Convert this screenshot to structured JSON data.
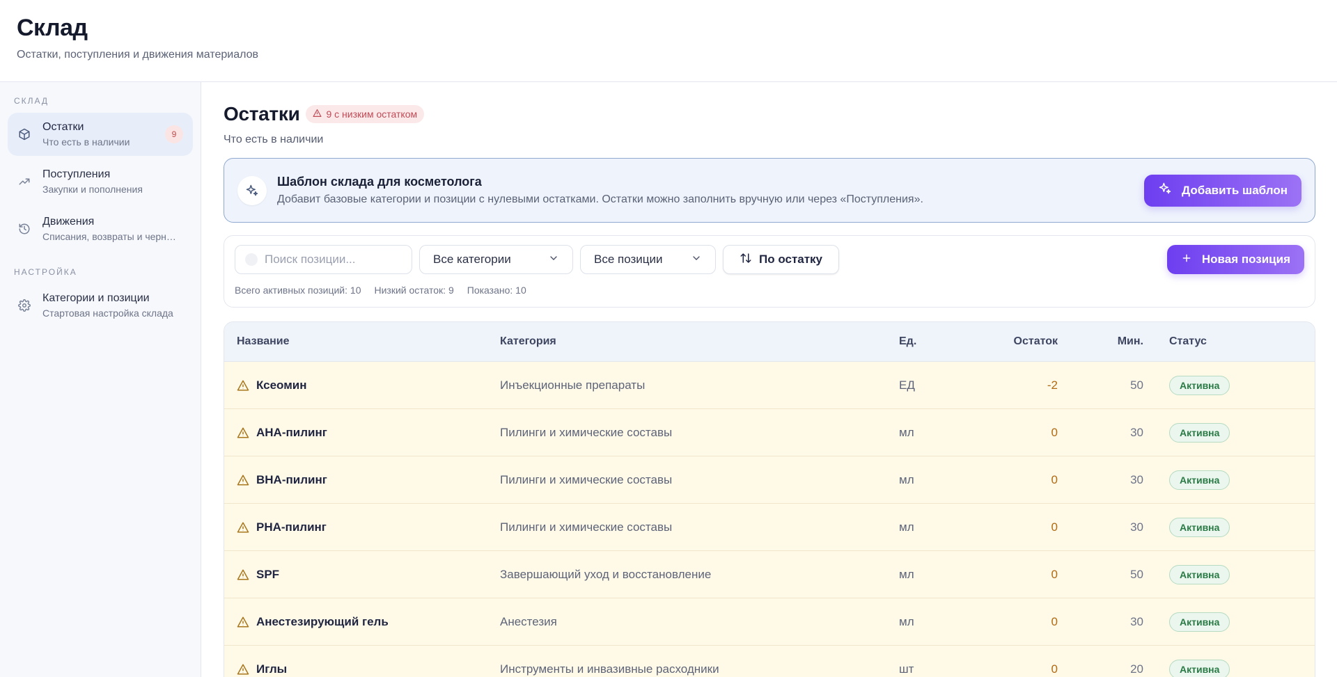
{
  "header": {
    "title": "Склад",
    "subtitle": "Остатки, поступления и движения материалов"
  },
  "sidebar": {
    "section_warehouse": "СКЛАД",
    "section_settings": "НАСТРОЙКА",
    "items": [
      {
        "title": "Остатки",
        "desc": "Что есть в наличии",
        "badge": "9",
        "icon": "box-icon",
        "active": true
      },
      {
        "title": "Поступления",
        "desc": "Закупки и пополнения",
        "icon": "trending-up-icon"
      },
      {
        "title": "Движения",
        "desc": "Списания, возвраты и черн…",
        "icon": "history-icon"
      },
      {
        "title": "Категории и позиции",
        "desc": "Стартовая настройка склада",
        "icon": "gear-icon"
      }
    ]
  },
  "main": {
    "title": "Остатки",
    "low_badge": "9 с низким остатком",
    "subtitle": "Что есть в наличии"
  },
  "template": {
    "title": "Шаблон склада для косметолога",
    "desc": "Добавит базовые категории и позиции с нулевыми остатками. Остатки можно заполнить вручную или через «Поступления».",
    "button": "Добавить шаблон"
  },
  "filters": {
    "search_placeholder": "Поиск позиции...",
    "category": "Все категории",
    "positions": "Все позиции",
    "sort": "По остатку",
    "new_button": "Новая позиция",
    "stats": {
      "total": "Всего активных позиций: 10",
      "low": "Низкий остаток: 9",
      "shown": "Показано: 10"
    }
  },
  "table": {
    "headers": {
      "name": "Название",
      "category": "Категория",
      "unit": "Ед.",
      "stock": "Остаток",
      "min": "Мин.",
      "status": "Статус"
    },
    "rows": [
      {
        "name": "Ксеомин",
        "category": "Инъекционные препараты",
        "unit": "ЕД",
        "stock": "-2",
        "min": "50",
        "status": "Активна"
      },
      {
        "name": "AHA-пилинг",
        "category": "Пилинги и химические составы",
        "unit": "мл",
        "stock": "0",
        "min": "30",
        "status": "Активна"
      },
      {
        "name": "BHA-пилинг",
        "category": "Пилинги и химические составы",
        "unit": "мл",
        "stock": "0",
        "min": "30",
        "status": "Активна"
      },
      {
        "name": "PHA-пилинг",
        "category": "Пилинги и химические составы",
        "unit": "мл",
        "stock": "0",
        "min": "30",
        "status": "Активна"
      },
      {
        "name": "SPF",
        "category": "Завершающий уход и восстановление",
        "unit": "мл",
        "stock": "0",
        "min": "50",
        "status": "Активна"
      },
      {
        "name": "Анестезирующий гель",
        "category": "Анестезия",
        "unit": "мл",
        "stock": "0",
        "min": "30",
        "status": "Активна"
      },
      {
        "name": "Иглы",
        "category": "Инструменты и инвазивные расходники",
        "unit": "шт",
        "stock": "0",
        "min": "20",
        "status": "Активна"
      }
    ]
  }
}
